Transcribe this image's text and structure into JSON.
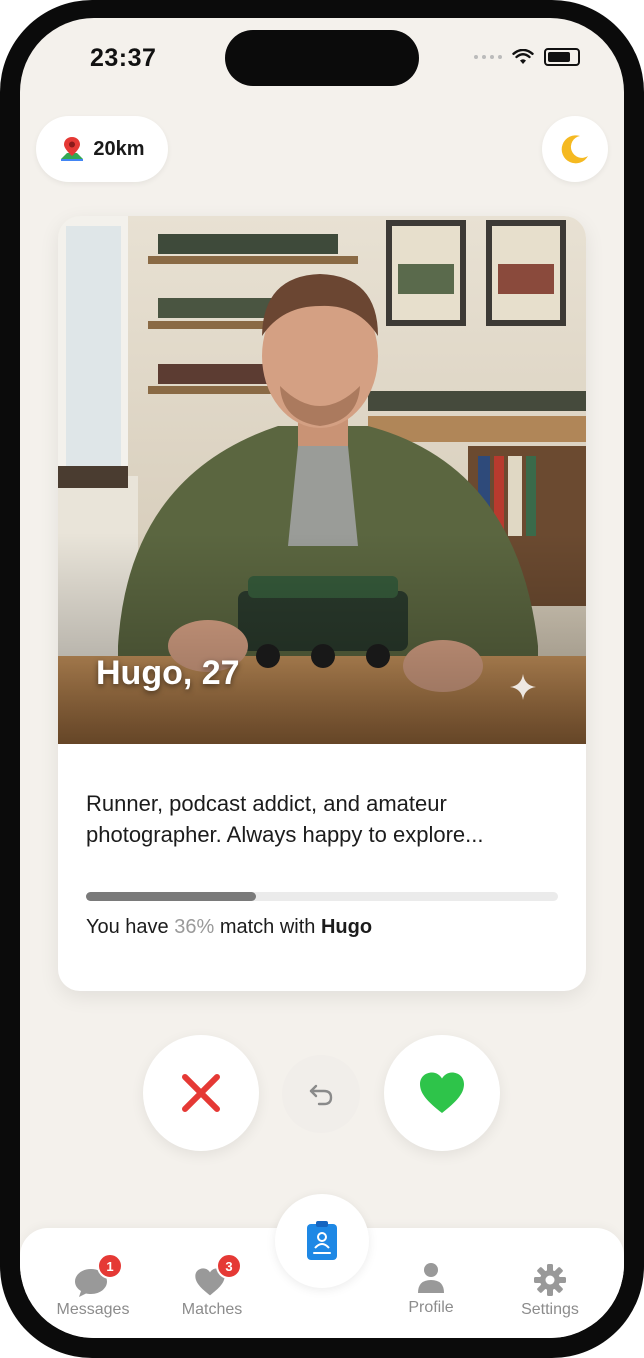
{
  "status_bar": {
    "time": "23:37"
  },
  "header": {
    "distance_label": "20km"
  },
  "profile_card": {
    "name_age": "Hugo, 27",
    "bio": "Runner, podcast addict, and amateur photographer. Always happy to explore...",
    "match_prefix": "You have ",
    "match_percent_text": "36%",
    "match_middle": " match with ",
    "match_name": "Hugo",
    "match_percent": 36
  },
  "tabbar": {
    "messages": {
      "label": "Messages",
      "badge": "1"
    },
    "matches": {
      "label": "Matches",
      "badge": "3"
    },
    "profile": {
      "label": "Profile"
    },
    "settings": {
      "label": "Settings"
    }
  },
  "colors": {
    "pass": "#e53935",
    "like": "#2ec44a",
    "center_tab": "#1e88e5",
    "background": "#f4f1ec"
  },
  "icons": {
    "distance": "map-pin-icon",
    "theme": "moon-icon",
    "pass": "close-icon",
    "undo": "undo-icon",
    "like": "heart-icon",
    "center": "profile-card-icon",
    "messages": "chat-bubble-icon",
    "matches": "heart-icon",
    "profile": "person-icon",
    "settings": "gear-icon"
  }
}
